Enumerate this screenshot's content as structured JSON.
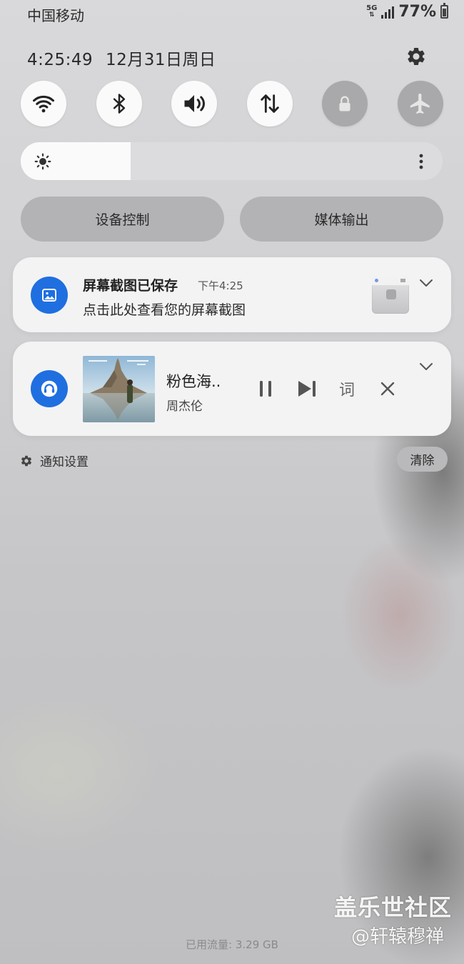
{
  "status_bar": {
    "carrier": "中国移动",
    "network": "5G",
    "battery_percent": "77%"
  },
  "header": {
    "time": "4:25:49",
    "date": "12月31日周日"
  },
  "quick_settings": [
    {
      "name": "wifi",
      "icon": "wifi-icon",
      "active": true
    },
    {
      "name": "bluetooth",
      "icon": "bluetooth-icon",
      "active": true
    },
    {
      "name": "sound",
      "icon": "volume-icon",
      "active": true
    },
    {
      "name": "mobile-data",
      "icon": "data-transfer-icon",
      "active": true
    },
    {
      "name": "rotation-lock",
      "icon": "lock-icon",
      "active": false
    },
    {
      "name": "airplane-mode",
      "icon": "airplane-icon",
      "active": false
    }
  ],
  "brightness": {
    "level": 0.26
  },
  "panel_buttons": {
    "device_control": "设备控制",
    "media_output": "媒体输出"
  },
  "notifications": {
    "screenshot": {
      "title": "屏幕截图已保存",
      "time": "下午4:25",
      "body": "点击此处查看您的屏幕截图"
    },
    "music": {
      "song": "粉色海..",
      "artist": "周杰伦",
      "lyrics_label": "词"
    }
  },
  "footer": {
    "notification_settings": "通知设置",
    "clear": "清除",
    "data_usage": "已用流量: 3.29 GB"
  },
  "watermark": {
    "line1": "盖乐世社区",
    "line2": "@轩辕穆禅"
  },
  "colors": {
    "accent": "#1f6fe0",
    "toggle_on": "#fafafa",
    "toggle_off": "#a9a9ab"
  }
}
